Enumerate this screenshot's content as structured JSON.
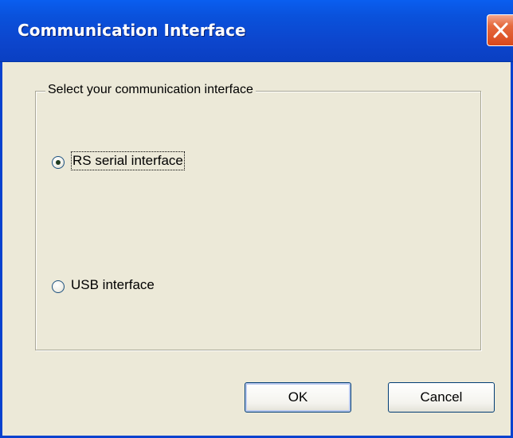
{
  "window": {
    "title": "Communication Interface"
  },
  "groupbox": {
    "label": "Select your communication interface"
  },
  "options": [
    {
      "label": "RS serial interface",
      "selected": true
    },
    {
      "label": "USB interface",
      "selected": false
    }
  ],
  "buttons": {
    "ok": "OK",
    "cancel": "Cancel"
  },
  "colors": {
    "titlebar": "#0a52dc",
    "close_button": "#e56a3e",
    "window_background": "#ece9d8"
  }
}
